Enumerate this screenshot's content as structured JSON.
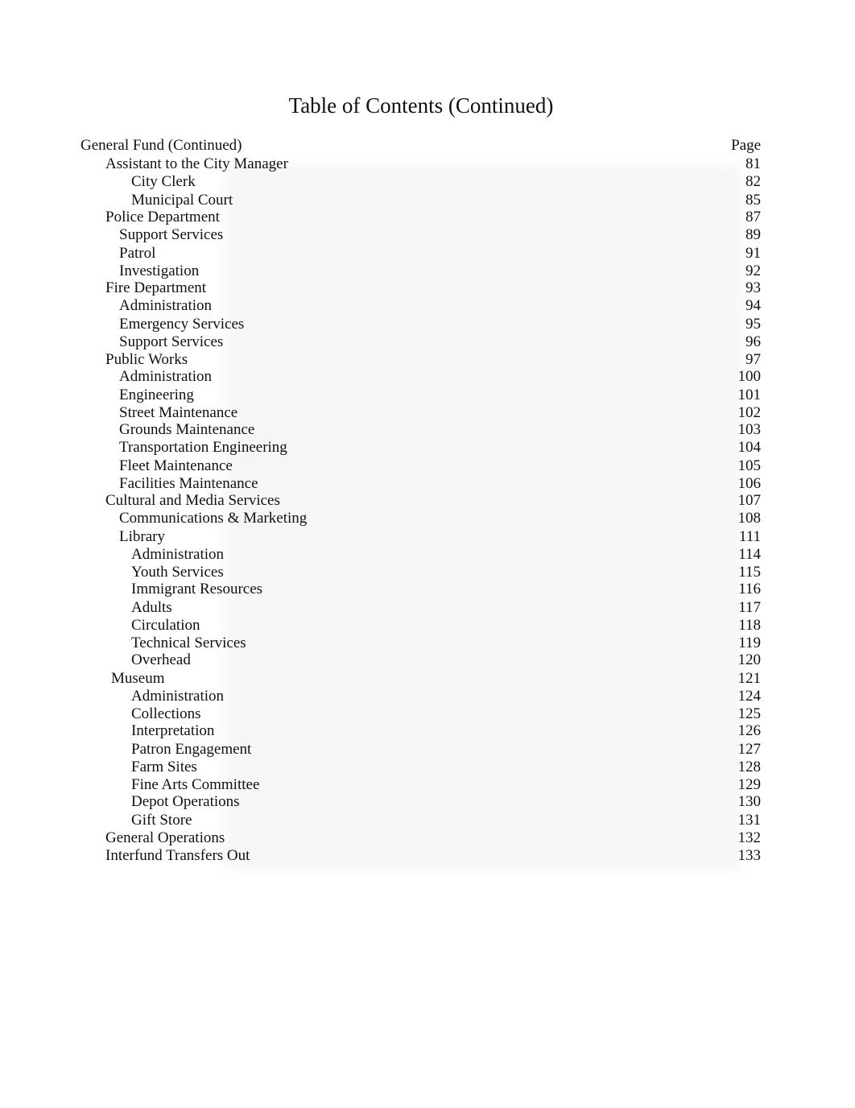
{
  "title": "Table of Contents (Continued)",
  "header": {
    "section": "General Fund (Continued)",
    "page_label": "Page"
  },
  "entries": [
    {
      "label": "Assistant to the City Manager",
      "page": "81",
      "level": 1
    },
    {
      "label": "City Clerk",
      "page": "82",
      "level": 3
    },
    {
      "label": "Municipal Court",
      "page": "85",
      "level": 3
    },
    {
      "label": "Police Department",
      "page": "87",
      "level": 1
    },
    {
      "label": "Support Services",
      "page": "89",
      "level": 2
    },
    {
      "label": "Patrol",
      "page": "91",
      "level": 2
    },
    {
      "label": "Investigation",
      "page": "92",
      "level": 2
    },
    {
      "label": "Fire Department",
      "page": "93",
      "level": 1
    },
    {
      "label": "Administration",
      "page": "94",
      "level": 2
    },
    {
      "label": "Emergency Services",
      "page": "95",
      "level": 2
    },
    {
      "label": "Support Services",
      "page": "96",
      "level": 2
    },
    {
      "label": "Public Works",
      "page": "97",
      "level": 1
    },
    {
      "label": "Administration",
      "page": "100",
      "level": 2
    },
    {
      "label": "Engineering",
      "page": "101",
      "level": 2
    },
    {
      "label": "Street Maintenance",
      "page": "102",
      "level": 2
    },
    {
      "label": "Grounds Maintenance",
      "page": "103",
      "level": 2
    },
    {
      "label": "Transportation Engineering",
      "page": "104",
      "level": 2
    },
    {
      "label": "Fleet Maintenance",
      "page": "105",
      "level": 2
    },
    {
      "label": "Facilities Maintenance",
      "page": "106",
      "level": 2
    },
    {
      "label": "Cultural and Media Services",
      "page": "107",
      "level": 1
    },
    {
      "label": "Communications & Marketing",
      "page": "108",
      "level": 2
    },
    {
      "label": "Library",
      "page": "111",
      "level": 2
    },
    {
      "label": "Administration",
      "page": "114",
      "level": 3
    },
    {
      "label": "Youth Services",
      "page": "115",
      "level": 3
    },
    {
      "label": "Immigrant Resources",
      "page": "116",
      "level": 3
    },
    {
      "label": "Adults",
      "page": "117",
      "level": 3
    },
    {
      "label": "Circulation",
      "page": "118",
      "level": 3
    },
    {
      "label": "Technical Services",
      "page": "119",
      "level": 3
    },
    {
      "label": "Overhead",
      "page": "120",
      "level": 3
    },
    {
      "label": "Museum",
      "page": "121",
      "level": 4
    },
    {
      "label": "Administration",
      "page": "124",
      "level": 3
    },
    {
      "label": "Collections",
      "page": "125",
      "level": 3
    },
    {
      "label": "Interpretation",
      "page": "126",
      "level": 3
    },
    {
      "label": "Patron Engagement",
      "page": "127",
      "level": 3
    },
    {
      "label": "Farm Sites",
      "page": "128",
      "level": 3
    },
    {
      "label": "Fine Arts Committee",
      "page": "129",
      "level": 3
    },
    {
      "label": "Depot Operations",
      "page": "130",
      "level": 3
    },
    {
      "label": "Gift Store",
      "page": "131",
      "level": 3
    },
    {
      "label": "General Operations",
      "page": "132",
      "level": 1
    },
    {
      "label": "Interfund Transfers Out",
      "page": "133",
      "level": 1
    }
  ]
}
